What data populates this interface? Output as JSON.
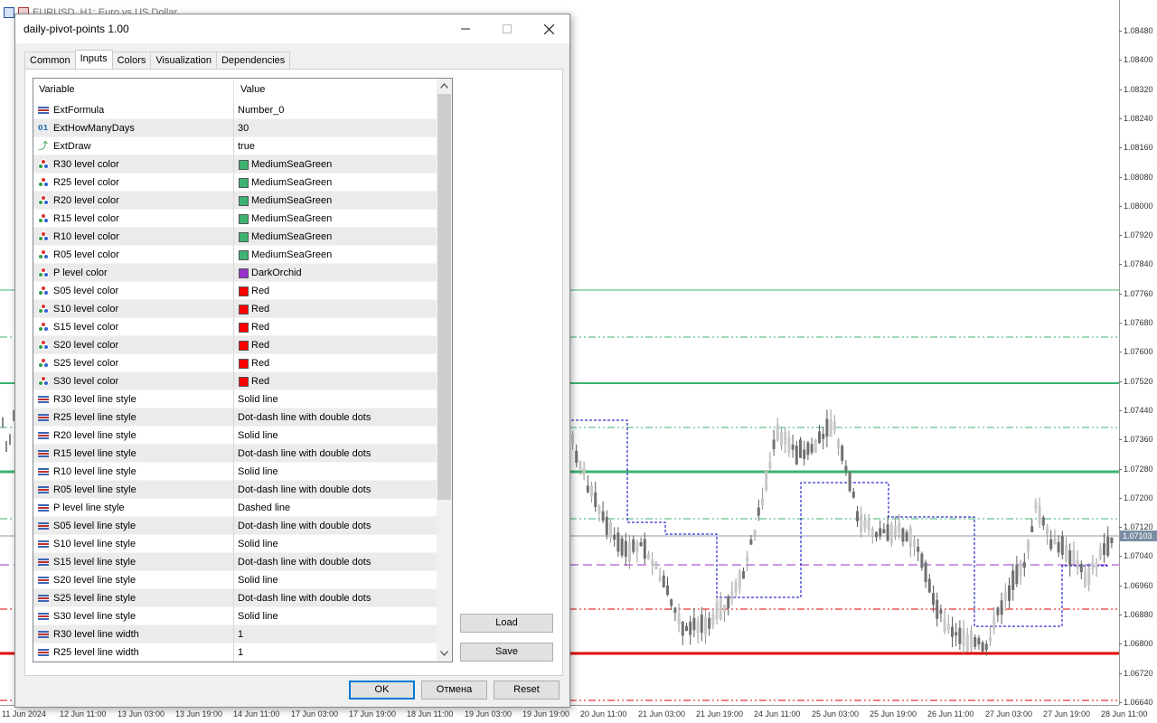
{
  "chart": {
    "window_title": "EURUSD, H1: Euro vs US Dollar",
    "current_price": "1.07103",
    "price_ticks": [
      "1.08480",
      "1.08400",
      "1.08320",
      "1.08240",
      "1.08160",
      "1.08080",
      "1.08000",
      "1.07920",
      "1.07840",
      "1.07760",
      "1.07680",
      "1.07600",
      "1.07520",
      "1.07440",
      "1.07360",
      "1.07280",
      "1.07200",
      "1.07120",
      "1.07040",
      "1.06960",
      "1.06880",
      "1.06800",
      "1.06720",
      "1.06640"
    ],
    "time_ticks": [
      "11 Jun 2024",
      "12 Jun 11:00",
      "13 Jun 03:00",
      "13 Jun 19:00",
      "14 Jun 11:00",
      "17 Jun 03:00",
      "17 Jun 19:00",
      "18 Jun 11:00",
      "19 Jun 03:00",
      "19 Jun 19:00",
      "20 Jun 11:00",
      "21 Jun 03:00",
      "21 Jun 19:00",
      "24 Jun 11:00",
      "25 Jun 03:00",
      "25 Jun 19:00",
      "26 Jun 11:00",
      "27 Jun 03:00",
      "27 Jun 19:00",
      "28 Jun 11:00"
    ],
    "colors": {
      "resistance": "#3CB371",
      "pivot": "#9932CC",
      "support": "#E00000",
      "pivot_step": "#0000C0"
    }
  },
  "dialog": {
    "title": "daily-pivot-points 1.00",
    "minimize_icon": "minimize-icon",
    "maximize_icon": "maximize-icon",
    "close_icon": "close-icon",
    "tabs": [
      {
        "label": "Common",
        "active": false
      },
      {
        "label": "Inputs",
        "active": true
      },
      {
        "label": "Colors",
        "active": false
      },
      {
        "label": "Visualization",
        "active": false
      },
      {
        "label": "Dependencies",
        "active": false
      }
    ],
    "grid": {
      "col_variable": "Variable",
      "col_value": "Value",
      "rows": [
        {
          "icon": "enum",
          "variable": "ExtFormula",
          "value": "Number_0"
        },
        {
          "icon": "int",
          "variable": "ExtHowManyDays",
          "value": "30"
        },
        {
          "icon": "bool",
          "variable": "ExtDraw",
          "value": "true"
        },
        {
          "icon": "color",
          "variable": "R30 level color",
          "value": "MediumSeaGreen",
          "swatch": "#3CB371"
        },
        {
          "icon": "color",
          "variable": "R25 level color",
          "value": "MediumSeaGreen",
          "swatch": "#3CB371"
        },
        {
          "icon": "color",
          "variable": "R20 level color",
          "value": "MediumSeaGreen",
          "swatch": "#3CB371"
        },
        {
          "icon": "color",
          "variable": "R15 level color",
          "value": "MediumSeaGreen",
          "swatch": "#3CB371"
        },
        {
          "icon": "color",
          "variable": "R10 level color",
          "value": "MediumSeaGreen",
          "swatch": "#3CB371"
        },
        {
          "icon": "color",
          "variable": "R05 level color",
          "value": "MediumSeaGreen",
          "swatch": "#3CB371"
        },
        {
          "icon": "color",
          "variable": "P level color",
          "value": "DarkOrchid",
          "swatch": "#9932CC"
        },
        {
          "icon": "color",
          "variable": "S05 level color",
          "value": "Red",
          "swatch": "#FF0000"
        },
        {
          "icon": "color",
          "variable": "S10 level color",
          "value": "Red",
          "swatch": "#FF0000"
        },
        {
          "icon": "color",
          "variable": "S15 level color",
          "value": "Red",
          "swatch": "#FF0000"
        },
        {
          "icon": "color",
          "variable": "S20 level color",
          "value": "Red",
          "swatch": "#FF0000"
        },
        {
          "icon": "color",
          "variable": "S25 level color",
          "value": "Red",
          "swatch": "#FF0000"
        },
        {
          "icon": "color",
          "variable": "S30 level color",
          "value": "Red",
          "swatch": "#FF0000"
        },
        {
          "icon": "enum",
          "variable": "R30 level line style",
          "value": "Solid line"
        },
        {
          "icon": "enum",
          "variable": "R25 level line style",
          "value": "Dot-dash line with double dots"
        },
        {
          "icon": "enum",
          "variable": "R20 level line style",
          "value": "Solid line"
        },
        {
          "icon": "enum",
          "variable": "R15 level line style",
          "value": "Dot-dash line with double dots"
        },
        {
          "icon": "enum",
          "variable": "R10 level line style",
          "value": "Solid line"
        },
        {
          "icon": "enum",
          "variable": "R05 level line style",
          "value": "Dot-dash line with double dots"
        },
        {
          "icon": "enum",
          "variable": "P level line style",
          "value": "Dashed line"
        },
        {
          "icon": "enum",
          "variable": "S05 level line style",
          "value": "Dot-dash line with double dots"
        },
        {
          "icon": "enum",
          "variable": "S10 level line style",
          "value": "Solid line"
        },
        {
          "icon": "enum",
          "variable": "S15 level line style",
          "value": "Dot-dash line with double dots"
        },
        {
          "icon": "enum",
          "variable": "S20 level line style",
          "value": "Solid line"
        },
        {
          "icon": "enum",
          "variable": "S25 level line style",
          "value": "Dot-dash line with double dots"
        },
        {
          "icon": "enum",
          "variable": "S30 level line style",
          "value": "Solid line"
        },
        {
          "icon": "enum",
          "variable": "R30 level line width",
          "value": "1"
        },
        {
          "icon": "enum",
          "variable": "R25 level line width",
          "value": "1"
        }
      ]
    },
    "buttons": {
      "load": "Load",
      "save": "Save",
      "ok": "OK",
      "cancel": "Отмена",
      "reset": "Reset"
    }
  }
}
